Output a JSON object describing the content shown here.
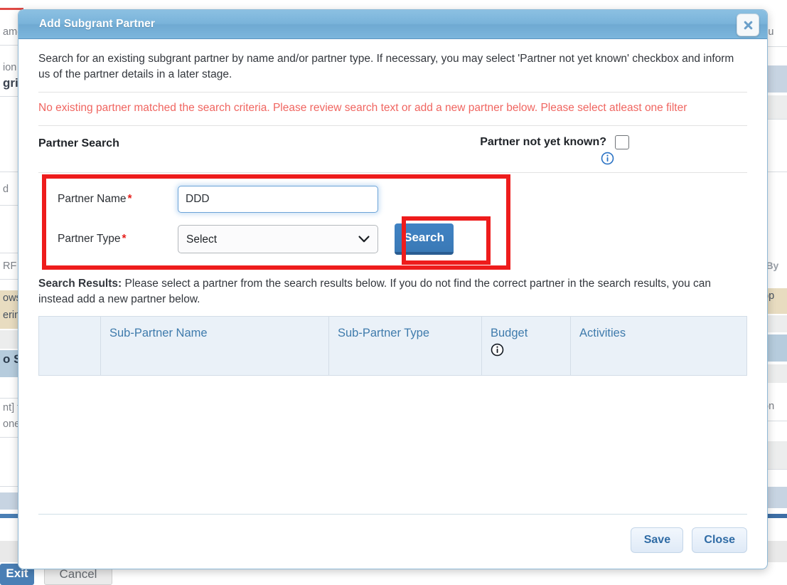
{
  "modal": {
    "title": "Add Subgrant Partner",
    "close_icon": "close-x-icon",
    "intro": "Search for an existing subgrant partner by name and/or partner type. If necessary, you may select 'Partner not yet known' checkbox and inform us of the partner details in a later stage.",
    "error_message": "No existing partner matched the search criteria. Please review search text or add a new partner below. Please select atleast one filter",
    "search_section": {
      "title": "Partner Search",
      "partner_not_yet_known_label": "Partner not yet known?",
      "partner_not_yet_known_checked": false,
      "info_icon": "info-circle-icon"
    },
    "form": {
      "partner_name_label": "Partner Name",
      "partner_name_value": "DDD",
      "partner_name_required": "*",
      "partner_type_label": "Partner Type",
      "partner_type_required": "*",
      "partner_type_value": "Select",
      "partner_type_options": [
        "Select"
      ],
      "search_button": "Search",
      "dropdown_icon": "chevron-down-icon"
    },
    "results": {
      "note_bold": "Search Results:",
      "note_text": " Please select a partner from the search results below. If you do not find the correct partner in the search results, you can instead add a new partner below.",
      "columns": [
        "",
        "Sub-Partner Name",
        "Sub-Partner Type",
        "Budget",
        "Activities"
      ],
      "budget_info_icon": "info-circle-icon",
      "rows": []
    },
    "footer": {
      "save_label": "Save",
      "close_label": "Close"
    }
  },
  "annotations": {
    "highlight_color": "#ee1c1c",
    "boxes": [
      "partner-search-form",
      "search-button"
    ]
  },
  "background": {
    "left_fragments": [
      "ame",
      "ion",
      "gri",
      "d",
      "RF",
      "ows",
      "ering",
      "o S",
      "nt] t",
      "one"
    ],
    "right_fragments": [
      "ocu",
      "d By",
      "upp",
      ": on"
    ],
    "exit_button": "Exit",
    "cancel_button": "Cancel"
  }
}
